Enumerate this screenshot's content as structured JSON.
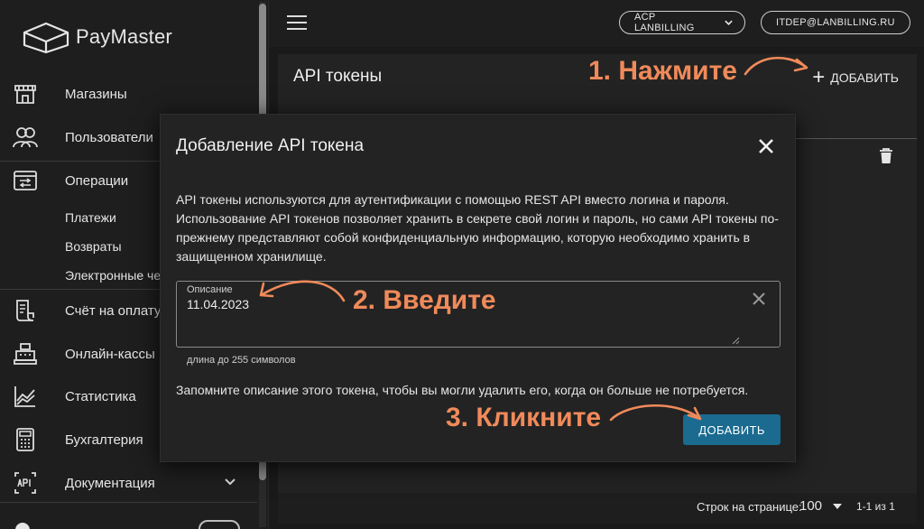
{
  "app": {
    "logo_text": "PayMaster"
  },
  "sidebar": {
    "items": [
      {
        "label": "Магазины",
        "icon": "store-icon"
      },
      {
        "label": "Пользователи",
        "icon": "users-icon"
      },
      {
        "label": "Операции",
        "icon": "operations-icon"
      },
      {
        "label": "Счёт на оплату",
        "icon": "invoice-icon"
      },
      {
        "label": "Онлайн-кассы",
        "icon": "cash-register-icon"
      },
      {
        "label": "Статистика",
        "icon": "chart-icon"
      },
      {
        "label": "Бухгалтерия",
        "icon": "calculator-icon"
      },
      {
        "label": "Документация",
        "icon": "api-doc-icon"
      }
    ],
    "sub_items": [
      "Платежи",
      "Возвраты",
      "Электронные че"
    ]
  },
  "topbar": {
    "account_pill": "ACP LANBILLING",
    "user_pill": "ITDEP@LANBILLING.RU"
  },
  "page": {
    "title": "API токены",
    "add_label": "ДОБАВИТЬ"
  },
  "footer": {
    "rows_label": "Строк на странице:",
    "rows_value": "100",
    "range": "1-1 из 1"
  },
  "dialog": {
    "title": "Добавление API токена",
    "description": "API токены используются для аутентификации с помощью REST API вместо логина и пароля. Использование API токенов позволяет хранить в секрете свой логин и пароль, но сами API токены по-прежнему представляют собой конфиденциальную информацию, которую необходимо хранить в защищенном хранилище.",
    "field_label": "Описание",
    "field_value": "11.04.2023",
    "hint": "длина до 255 символов",
    "remember": "Запомните описание этого токена, чтобы вы могли удалить его, когда он больше не потребуется.",
    "add_label": "ДОБАВИТЬ"
  },
  "annotations": {
    "step1": "1. Нажмите",
    "step2": "2. Введите",
    "step3": "3. Кликните"
  },
  "colors": {
    "accent": "#1a6b8f",
    "annotation": "#f08a5a"
  }
}
